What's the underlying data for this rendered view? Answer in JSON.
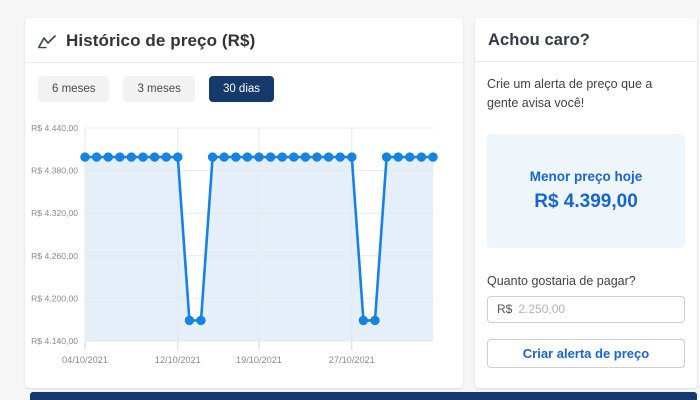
{
  "price_history": {
    "title": "Histórico de preço (R$)",
    "tabs": [
      {
        "label": "6 meses",
        "selected": false
      },
      {
        "label": "3 meses",
        "selected": false
      },
      {
        "label": "30 dias",
        "selected": true
      }
    ]
  },
  "chart_data": {
    "type": "line",
    "title": "Histórico de preço (R$)",
    "x_count": 31,
    "values": [
      4399,
      4399,
      4399,
      4399,
      4399,
      4399,
      4399,
      4399,
      4399,
      4169,
      4169,
      4399,
      4399,
      4399,
      4399,
      4399,
      4399,
      4399,
      4399,
      4399,
      4399,
      4399,
      4399,
      4399,
      4169,
      4169,
      4399,
      4399,
      4399,
      4399,
      4399
    ],
    "ylim": [
      4140,
      4440
    ],
    "y_ticks": [
      {
        "label": "R$ 4.440,00",
        "value": 4440
      },
      {
        "label": "R$ 4.380,00",
        "value": 4380
      },
      {
        "label": "R$ 4.320,00",
        "value": 4320
      },
      {
        "label": "R$ 4.260,00",
        "value": 4260
      },
      {
        "label": "R$ 4.200,00",
        "value": 4200
      },
      {
        "label": "R$ 4.140,00",
        "value": 4140
      }
    ],
    "x_ticks": [
      {
        "label": "04/10/2021",
        "index": 0
      },
      {
        "label": "12/10/2021",
        "index": 8
      },
      {
        "label": "19/10/2021",
        "index": 15
      },
      {
        "label": "27/10/2021",
        "index": 23
      }
    ],
    "grid": true,
    "legend": "none",
    "line_color": "#1583e3",
    "area_color": "#e4effa",
    "grid_color": "#e6e8eb",
    "tick_label_color": "#8c8c8c"
  },
  "alert_panel": {
    "title": "Achou caro?",
    "description": "Crie um alerta de preço que a gente avisa você!",
    "best_price_label": "Menor preço hoje",
    "best_price_value": "R$ 4.399,00",
    "question_label": "Quanto gostaria de pagar?",
    "input_prefix": "R$",
    "input_placeholder": "2.250,00",
    "button_label": "Criar alerta de preço"
  },
  "colors": {
    "accent_navy": "#15386d",
    "link_blue": "#1565d8",
    "chart_blue": "#1583e3",
    "best_price_box_bg": "#eef6fc",
    "page_bg": "#f6f6f6"
  }
}
